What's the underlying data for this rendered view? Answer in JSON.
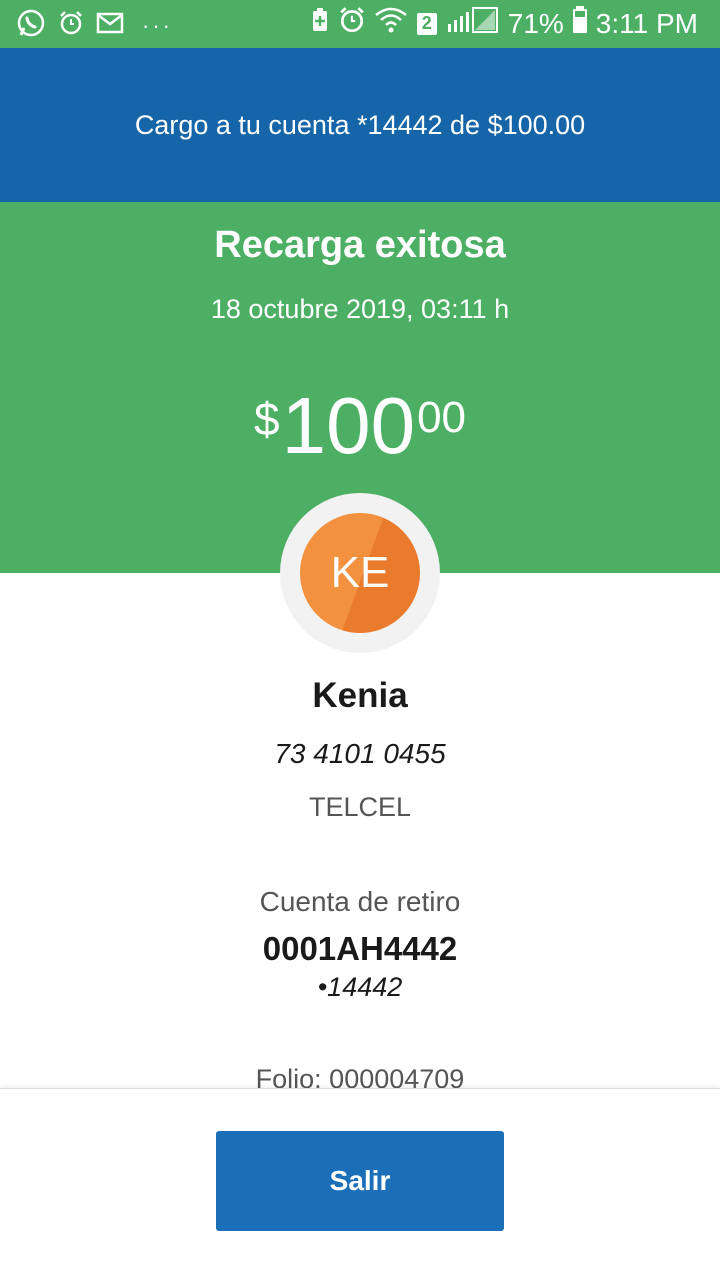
{
  "status_bar": {
    "battery_pct": "71%",
    "time": "3:11 PM",
    "sim": "2",
    "dots": "···",
    "icons": [
      "whatsapp-icon",
      "alarm-icon",
      "mail-icon",
      "battery-saver-icon",
      "alarm-icon",
      "wifi-icon",
      "signal-icon",
      "battery-icon"
    ]
  },
  "banner": {
    "text": "Cargo a tu cuenta *14442 de $100.00"
  },
  "result": {
    "title": "Recarga exitosa",
    "date": "18 octubre 2019, 03:11 h",
    "amount": {
      "currency": "$",
      "integer": "100",
      "decimals": "00"
    }
  },
  "contact": {
    "initials": "KE",
    "name": "Kenia",
    "phone": "73 4101 0455",
    "carrier": "TELCEL"
  },
  "account": {
    "label": "Cuenta de retiro",
    "number": "0001AH4442",
    "short": "•14442"
  },
  "folio": "Folio: 000004709",
  "actions": {
    "exit_label": "Salir"
  },
  "colors": {
    "green": "#4caf64",
    "blue": "#1565a8",
    "button": "#1a6fb8",
    "avatar": "#f2913f"
  }
}
